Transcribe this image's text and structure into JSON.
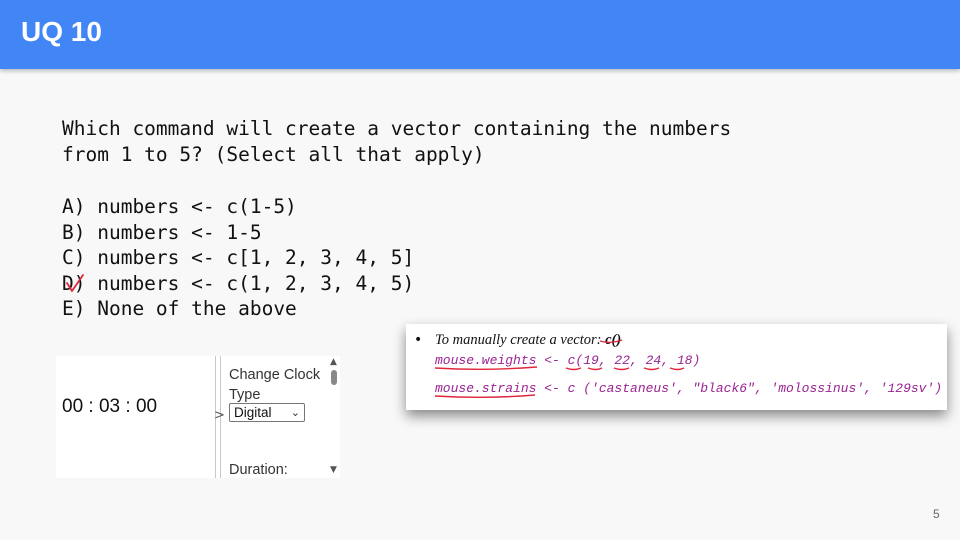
{
  "slide": {
    "title": "UQ 10",
    "page_number": "5"
  },
  "question": {
    "line1": "Which command will create a vector containing the numbers",
    "line2": "from 1 to 5? (Select all that apply)"
  },
  "options": [
    "A) numbers <- c(1-5)",
    "B) numbers <- 1-5",
    "C) numbers <- c[1, 2, 3, 4, 5]",
    "D) numbers <- c(1, 2, 3, 4, 5)",
    "E) None of the above"
  ],
  "annotation": {
    "mark_color": "#e0263a",
    "marked_option": "D"
  },
  "clock_widget": {
    "time": "00 : 03 : 00",
    "arrow": ">",
    "change_label": "Change Clock Type",
    "select_value": "Digital",
    "duration_label": "Duration:"
  },
  "code_card": {
    "bullet_text": "To manually create a vector: ",
    "bullet_fn": "c()",
    "line1": "mouse.weights <- c(19, 22, 24, 18)",
    "line2": "mouse.strains <- c ('castaneus', \"black6\", 'molossinus', '129sv')",
    "code_color": "#9b2393"
  },
  "colors": {
    "header": "#4285f4",
    "background": "#f8f8f8"
  }
}
